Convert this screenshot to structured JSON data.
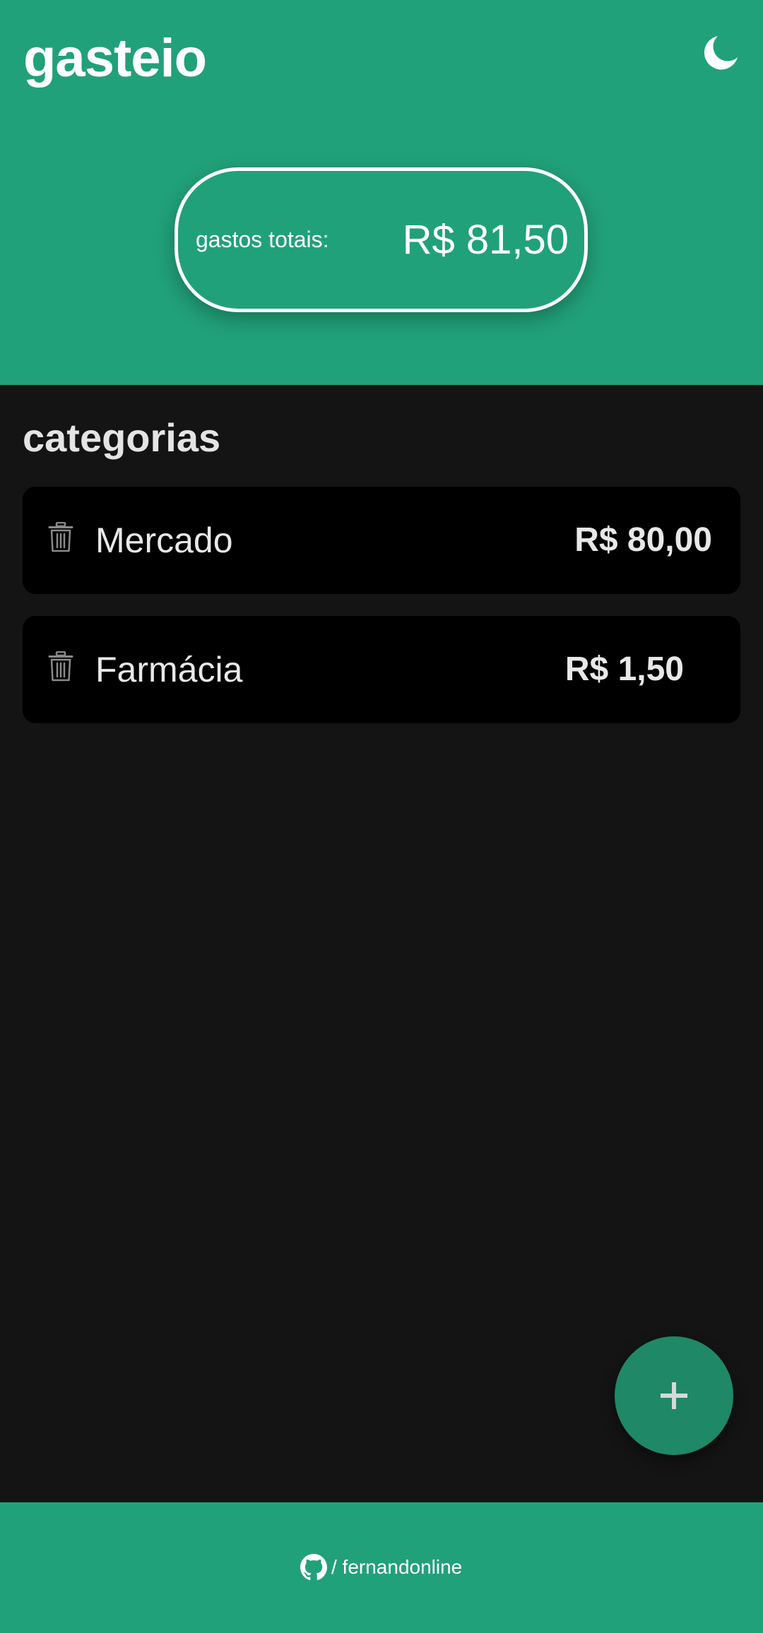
{
  "header": {
    "title": "gasteio",
    "theme_icon": "moon-icon",
    "background_color": "#21a179"
  },
  "summary": {
    "label": "gastos totais:",
    "value": "R$ 81,50"
  },
  "categories": {
    "title": "categorias",
    "items": [
      {
        "name": "Mercado",
        "amount": "R$ 80,00",
        "icon": "trash-icon"
      },
      {
        "name": "Farmácia",
        "amount": "R$ 1,50",
        "icon": "trash-icon"
      }
    ]
  },
  "fab": {
    "icon": "plus-icon",
    "color": "#1f8866"
  },
  "footer": {
    "icon": "github-icon",
    "link_text": "/ fernandonline"
  }
}
